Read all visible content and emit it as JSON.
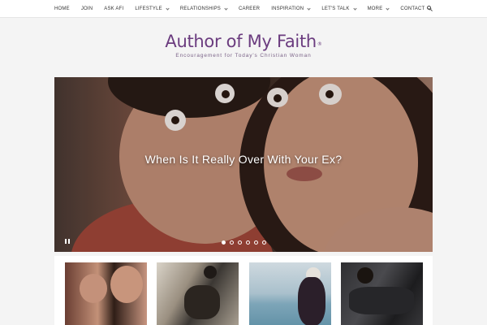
{
  "nav": {
    "items": [
      {
        "label": "HOME",
        "dropdown": false
      },
      {
        "label": "JOIN",
        "dropdown": false
      },
      {
        "label": "ASK AFI",
        "dropdown": false
      },
      {
        "label": "LIFESTYLE",
        "dropdown": true
      },
      {
        "label": "RELATIONSHIPS",
        "dropdown": true
      },
      {
        "label": "CAREER",
        "dropdown": false
      },
      {
        "label": "INSPIRATION",
        "dropdown": true
      },
      {
        "label": "LET'S TALK",
        "dropdown": true
      },
      {
        "label": "MORE",
        "dropdown": true
      },
      {
        "label": "CONTACT",
        "dropdown": true
      }
    ],
    "search_icon": "search-icon"
  },
  "logo": {
    "title": "Author of My Faith",
    "registered": "®",
    "tagline": "Encouragement for Today's Christian Woman"
  },
  "slider": {
    "title": "When Is It Really Over With Your Ex?",
    "slide_count": 6,
    "active_slide": 1,
    "pause_icon": "pause-icon"
  },
  "cards": {
    "count": 4
  },
  "colors": {
    "brand": "#6b3c7f",
    "nav_bg": "#ffffff",
    "page_bg": "#f4f4f4"
  }
}
